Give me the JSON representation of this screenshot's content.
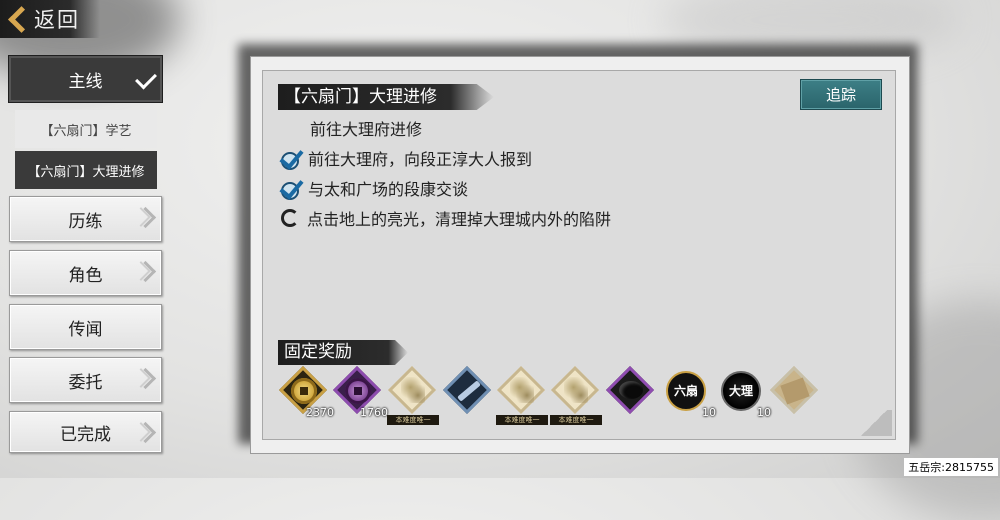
{
  "header": {
    "back_label": "返回"
  },
  "menu": {
    "main_label": "主线",
    "sub_items": [
      "【六扇门】学艺",
      "【六扇门】大理进修"
    ],
    "items": [
      "历练",
      "角色",
      "传闻",
      "委托",
      "已完成"
    ]
  },
  "quest": {
    "title": "【六扇门】大理进修",
    "track_label": "追踪",
    "subtitle": "前往大理府进修",
    "objectives": [
      {
        "text": "前往大理府，向段正淳大人报到",
        "status": "done"
      },
      {
        "text": "与太和广场的段康交谈",
        "status": "done"
      },
      {
        "text": "点击地上的亮光，清理掉大理城内外的陷阱",
        "status": "pending"
      }
    ]
  },
  "rewards": {
    "title": "固定奖励",
    "items": [
      {
        "icon": "gold-coin-icon",
        "qty": "2370",
        "tag": ""
      },
      {
        "icon": "purple-coin-icon",
        "qty": "1760",
        "tag": ""
      },
      {
        "icon": "treasure-map-icon",
        "qty": "",
        "tag": "本难度唯一"
      },
      {
        "icon": "blade-icon",
        "qty": "",
        "tag": ""
      },
      {
        "icon": "treasure-map-icon",
        "qty": "",
        "tag": "本难度唯一"
      },
      {
        "icon": "treasure-map-icon",
        "qty": "",
        "tag": "本难度唯一"
      },
      {
        "icon": "black-stone-icon",
        "qty": "",
        "tag": ""
      },
      {
        "icon": "liushan-medal-icon",
        "qty": "10",
        "tag": "",
        "glyph": "六扇"
      },
      {
        "icon": "dali-medal-icon",
        "qty": "10",
        "tag": "",
        "glyph": "大理"
      },
      {
        "icon": "wood-plank-icon",
        "qty": "",
        "tag": ""
      }
    ]
  },
  "watermark": "五岳宗:2815755"
}
